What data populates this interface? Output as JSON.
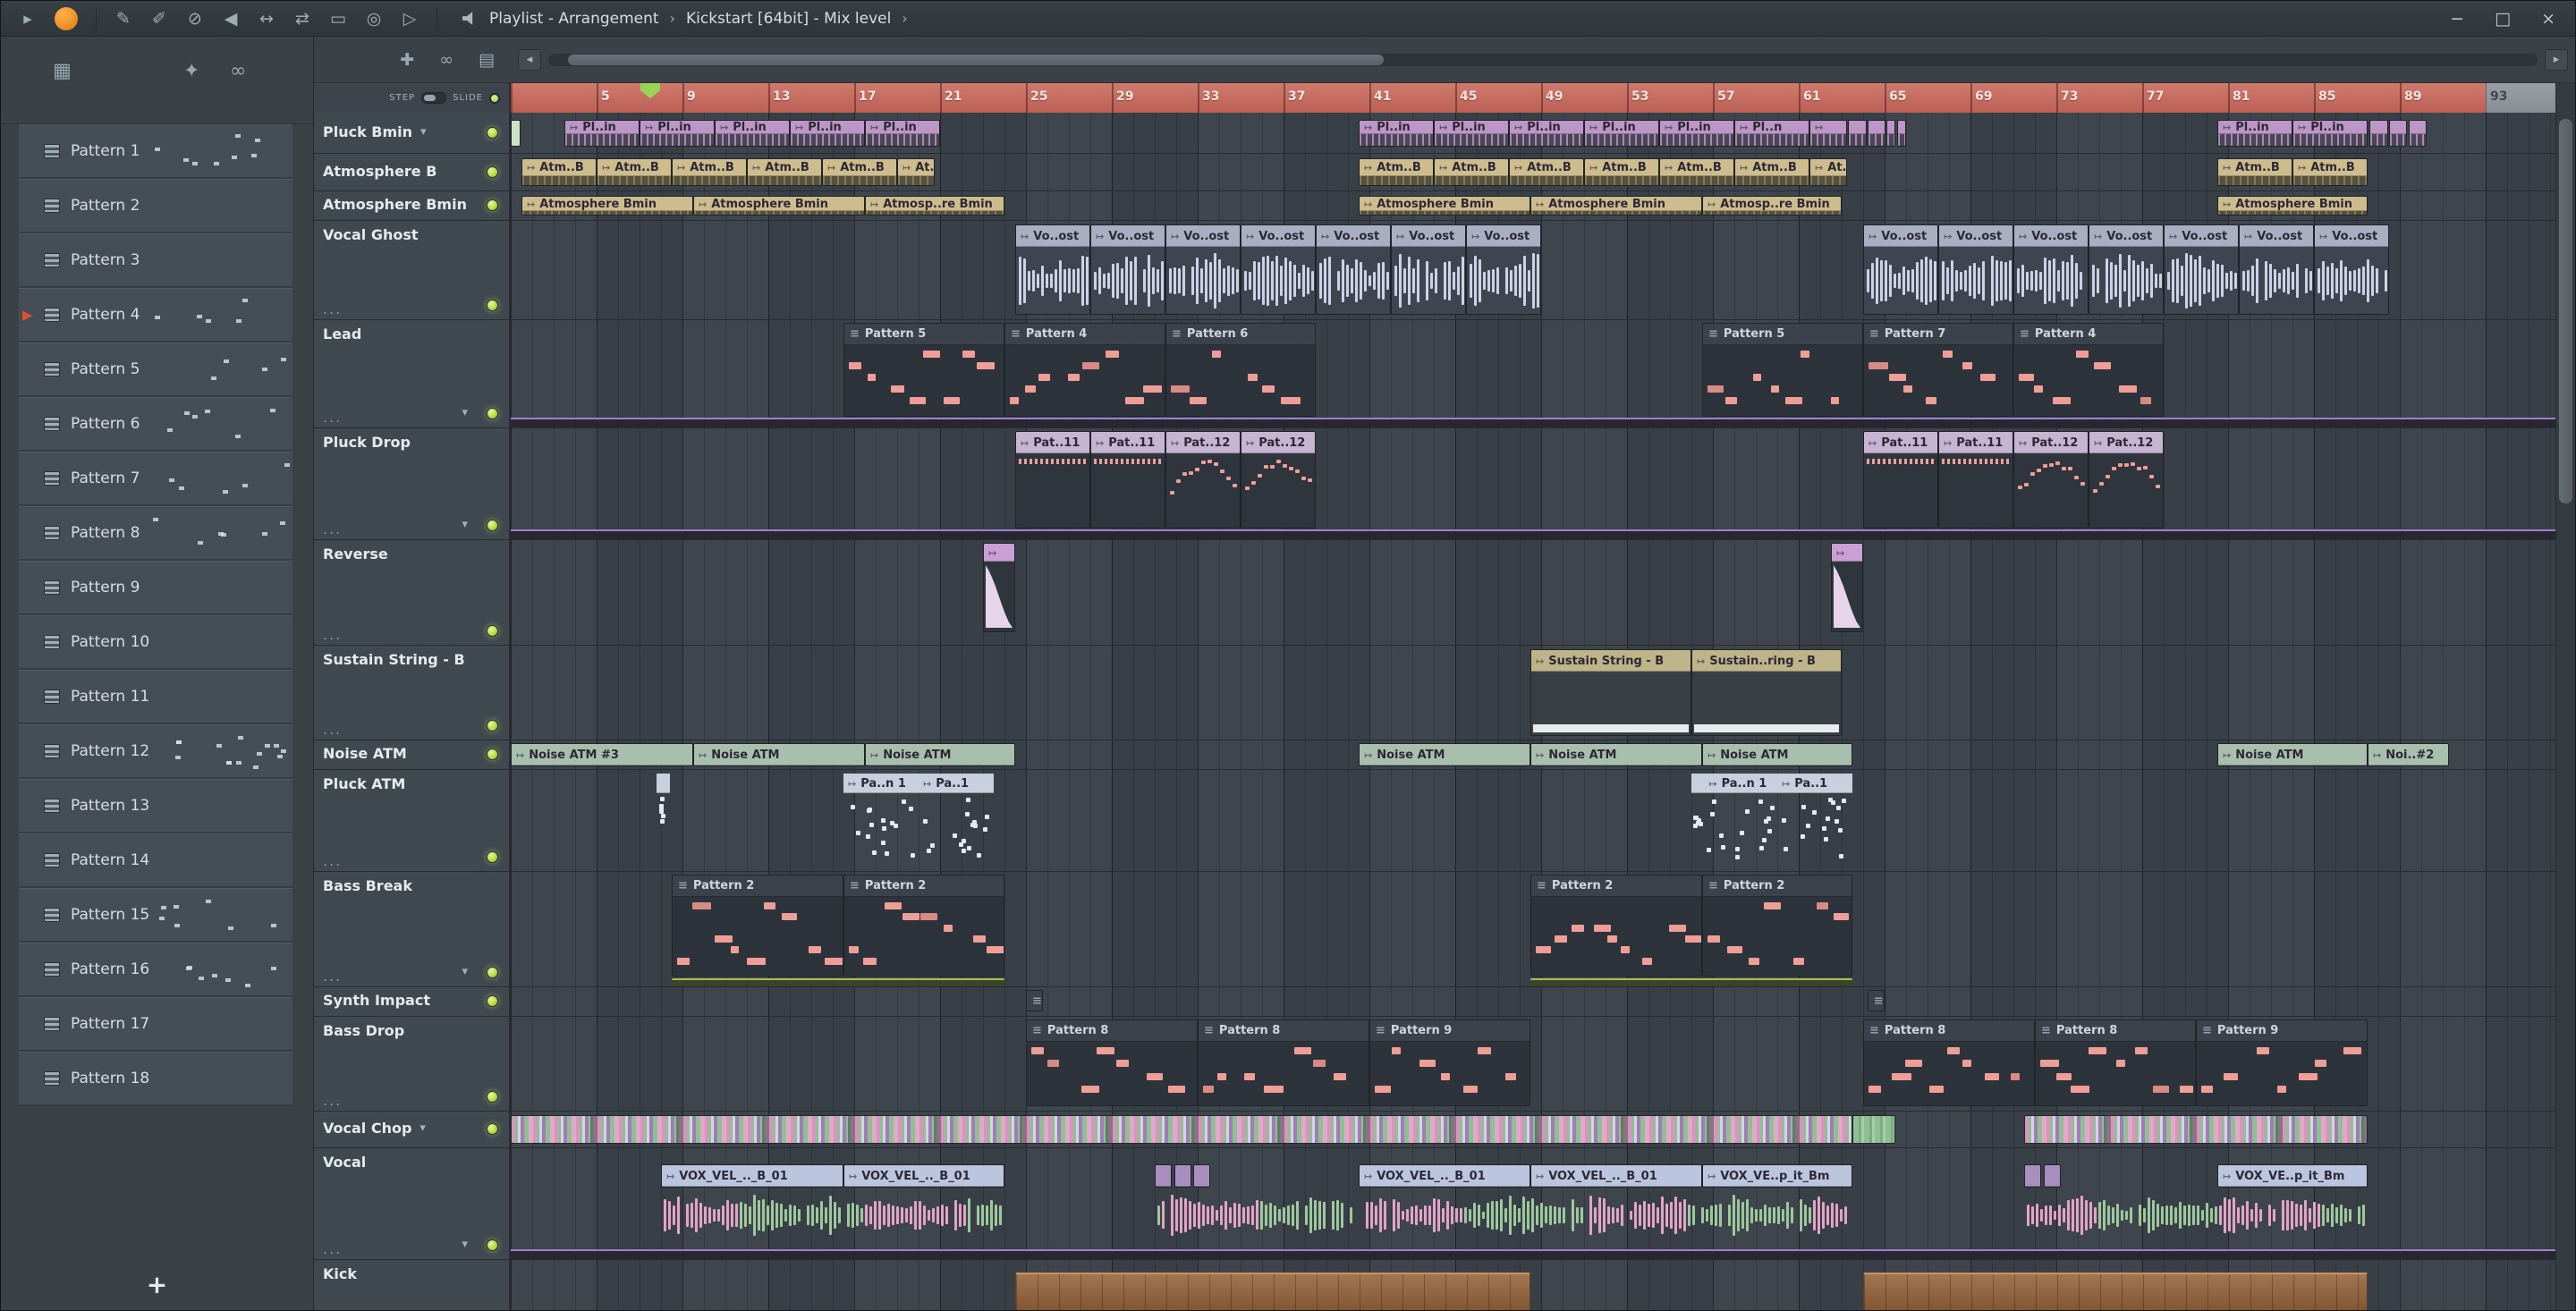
{
  "titlebar": {
    "play_glyph": "▸",
    "tools": [
      {
        "name": "draw-tool-icon",
        "glyph": "✎"
      },
      {
        "name": "paint-tool-icon",
        "glyph": "✐"
      },
      {
        "name": "delete-tool-icon",
        "glyph": "⊘"
      },
      {
        "name": "mute-tool-icon",
        "glyph": "◀"
      },
      {
        "name": "slip-tool-icon",
        "glyph": "↔"
      },
      {
        "name": "slide-tool-icon",
        "glyph": "⇄"
      },
      {
        "name": "select-tool-icon",
        "glyph": "▭"
      },
      {
        "name": "zoom-tool-icon",
        "glyph": "◎"
      },
      {
        "name": "playback-tool-icon",
        "glyph": "▷"
      }
    ],
    "title_left": "Playlist - Arrangement",
    "title_sep": "›",
    "title_right": "Kickstart [64bit] - Mix level",
    "window_controls": {
      "minimize": "−",
      "maximize": "□",
      "close": "×"
    }
  },
  "left_panel": {
    "tabs": [
      {
        "name": "patterns-tab-icon",
        "glyph": "▦"
      },
      {
        "name": "audio-tab-icon",
        "glyph": "✦"
      },
      {
        "name": "automation-tab-icon",
        "glyph": "∞"
      }
    ],
    "patterns": [
      "Pattern 1",
      "Pattern 2",
      "Pattern 3",
      "Pattern 4",
      "Pattern 5",
      "Pattern 6",
      "Pattern 7",
      "Pattern 8",
      "Pattern 9",
      "Pattern 10",
      "Pattern 11",
      "Pattern 12",
      "Pattern 13",
      "Pattern 14",
      "Pattern 15",
      "Pattern 16",
      "Pattern 17",
      "Pattern 18"
    ],
    "active_pattern": "Pattern 4",
    "preview_patterns": [
      1,
      4,
      5,
      6,
      7,
      8,
      12,
      15,
      16
    ],
    "add_label": "+"
  },
  "playlist": {
    "tools": [
      {
        "name": "arrange-icon",
        "glyph": "✚"
      },
      {
        "name": "link-icon",
        "glyph": "∞"
      },
      {
        "name": "view-icon",
        "glyph": "▤"
      }
    ],
    "scroll_left_glyph": "◂",
    "scroll_right_glyph": "▸",
    "step_label": "STEP",
    "slide_label": "SLIDE",
    "ruler_numbers": [
      5,
      9,
      13,
      17,
      21,
      25,
      29,
      33,
      37,
      41,
      45,
      49,
      53,
      57,
      61,
      65,
      69,
      73,
      77,
      81,
      85,
      89,
      93
    ],
    "playhead_bar": 7.5,
    "tracks": [
      {
        "name": "Pluck Bmin",
        "h": 46,
        "led": "top",
        "arrow": "inline"
      },
      {
        "name": "Atmosphere B",
        "h": 42,
        "led": "top"
      },
      {
        "name": "Atmosphere Bmin",
        "h": 33,
        "led": "top"
      },
      {
        "name": "Vocal Ghost",
        "h": 111,
        "led": "bottom",
        "dots": true
      },
      {
        "name": "Lead",
        "h": 121,
        "led": "bottom",
        "dots": true,
        "arrow": "bottom",
        "autoline": true
      },
      {
        "name": "Pluck Drop",
        "h": 125,
        "led": "bottom",
        "dots": true,
        "arrow": "bottom",
        "autoline": true
      },
      {
        "name": "Reverse",
        "h": 118,
        "led": "bottom",
        "dots": true
      },
      {
        "name": "Sustain String - B",
        "h": 106,
        "led": "bottom",
        "dots": true
      },
      {
        "name": "Noise ATM",
        "h": 33,
        "led": "top"
      },
      {
        "name": "Pluck ATM",
        "h": 114,
        "led": "bottom",
        "dots": true
      },
      {
        "name": "Bass Break",
        "h": 129,
        "led": "bottom",
        "dots": true,
        "arrow": "bottom"
      },
      {
        "name": "Synth Impact",
        "h": 33,
        "led": "top"
      },
      {
        "name": "Bass Drop",
        "h": 106,
        "led": "bottom",
        "dots": true
      },
      {
        "name": "Vocal Chop",
        "h": 41,
        "led": "top",
        "arrow": "inline"
      },
      {
        "name": "Vocal",
        "h": 125,
        "led": "bottom",
        "dots": true,
        "arrow": "bottom",
        "autoline": true
      },
      {
        "name": "Kick",
        "h": 60,
        "led": "none"
      }
    ],
    "clips": [
      [
        0,
        1,
        0.45,
        "",
        "sliver"
      ],
      [
        0,
        3.5,
        3.5,
        "Pl..in",
        "pluck"
      ],
      [
        0,
        7,
        3.5,
        "Pl..in",
        "pluck"
      ],
      [
        0,
        10.5,
        3.5,
        "Pl..in",
        "pluck"
      ],
      [
        0,
        14,
        3.5,
        "Pl..in",
        "pluck"
      ],
      [
        0,
        17.5,
        3.5,
        "Pl..in",
        "pluck"
      ],
      [
        0,
        40.5,
        3.5,
        "Pl..in",
        "pluck"
      ],
      [
        0,
        44,
        3.5,
        "Pl..in",
        "pluck"
      ],
      [
        0,
        47.5,
        3.5,
        "Pl..in",
        "pluck"
      ],
      [
        0,
        51,
        3.5,
        "Pl..in",
        "pluck"
      ],
      [
        0,
        54.5,
        3.5,
        "Pl..in",
        "pluck"
      ],
      [
        0,
        58,
        3.5,
        "Pl..n",
        "pluck"
      ],
      [
        0,
        61.5,
        1.75,
        "",
        "pluck"
      ],
      [
        0,
        63.3,
        0.85,
        "",
        "pluck"
      ],
      [
        0,
        64.2,
        0.85,
        "",
        "pluck"
      ],
      [
        0,
        65.1,
        0.4,
        "",
        "pluck"
      ],
      [
        0,
        65.6,
        0.4,
        "",
        "pluck"
      ],
      [
        0,
        80.5,
        3.5,
        "Pl..in",
        "pluck"
      ],
      [
        0,
        84,
        3.5,
        "Pl..in",
        "pluck"
      ],
      [
        0,
        87.6,
        0.85,
        "",
        "pluck"
      ],
      [
        0,
        88.5,
        0.85,
        "",
        "pluck"
      ],
      [
        0,
        89.4,
        0.85,
        "",
        "pluck"
      ],
      [
        1,
        1.5,
        3.5,
        "Atm..B",
        "atmo"
      ],
      [
        1,
        5,
        3.5,
        "Atm..B",
        "atmo"
      ],
      [
        1,
        8.5,
        3.5,
        "Atm..B",
        "atmo"
      ],
      [
        1,
        12,
        3.5,
        "Atm..B",
        "atmo"
      ],
      [
        1,
        15.5,
        3.5,
        "Atm..B",
        "atmo"
      ],
      [
        1,
        19,
        1.75,
        "At..B",
        "atmo"
      ],
      [
        1,
        40.5,
        3.5,
        "Atm..B",
        "atmo"
      ],
      [
        1,
        44,
        3.5,
        "Atm..B",
        "atmo"
      ],
      [
        1,
        47.5,
        3.5,
        "Atm..B",
        "atmo"
      ],
      [
        1,
        51,
        3.5,
        "Atm..B",
        "atmo"
      ],
      [
        1,
        54.5,
        3.5,
        "Atm..B",
        "atmo"
      ],
      [
        1,
        58,
        3.5,
        "Atm..B",
        "atmo"
      ],
      [
        1,
        61.5,
        1.75,
        "At..B",
        "atmo"
      ],
      [
        1,
        80.5,
        3.5,
        "Atm..B",
        "atmo"
      ],
      [
        1,
        84,
        3.5,
        "Atm..B",
        "atmo"
      ],
      [
        2,
        1.5,
        8,
        "Atmosphere Bmin",
        "atmo"
      ],
      [
        2,
        9.5,
        8,
        "Atmosphere Bmin",
        "atmo"
      ],
      [
        2,
        17.5,
        6.5,
        "Atmosp..re Bmin",
        "atmo"
      ],
      [
        2,
        40.5,
        8,
        "Atmosphere Bmin",
        "atmo"
      ],
      [
        2,
        48.5,
        8,
        "Atmosphere Bmin",
        "atmo"
      ],
      [
        2,
        56.5,
        6.5,
        "Atmosp..re Bmin",
        "atmo"
      ],
      [
        2,
        80.5,
        7,
        "Atmosphere Bmin",
        "atmo"
      ],
      [
        3,
        24.5,
        3.5,
        "Vo..ost",
        "ghost"
      ],
      [
        3,
        28,
        3.5,
        "Vo..ost",
        "ghost"
      ],
      [
        3,
        31.5,
        3.5,
        "Vo..ost",
        "ghost"
      ],
      [
        3,
        35,
        3.5,
        "Vo..ost",
        "ghost"
      ],
      [
        3,
        38.5,
        3.5,
        "Vo..ost",
        "ghost"
      ],
      [
        3,
        42,
        3.5,
        "Vo..ost",
        "ghost"
      ],
      [
        3,
        45.5,
        3.5,
        "Vo..ost",
        "ghost"
      ],
      [
        3,
        64,
        3.5,
        "Vo..ost",
        "ghost"
      ],
      [
        3,
        67.5,
        3.5,
        "Vo..ost",
        "ghost"
      ],
      [
        3,
        71,
        3.5,
        "Vo..ost",
        "ghost"
      ],
      [
        3,
        74.5,
        3.5,
        "Vo..ost",
        "ghost"
      ],
      [
        3,
        78,
        3.5,
        "Vo..ost",
        "ghost"
      ],
      [
        3,
        81.5,
        3.5,
        "Vo..ost",
        "ghost"
      ],
      [
        3,
        85,
        3.5,
        "Vo..ost",
        "ghost"
      ],
      [
        4,
        16.5,
        7.5,
        "Pattern 5",
        "midi"
      ],
      [
        4,
        24,
        7.5,
        "Pattern 4",
        "midi"
      ],
      [
        4,
        31.5,
        7,
        "Pattern 6",
        "midi"
      ],
      [
        4,
        56.5,
        7.5,
        "Pattern 5",
        "midi"
      ],
      [
        4,
        64,
        7,
        "Pattern 7",
        "midi"
      ],
      [
        4,
        71,
        7,
        "Pattern 4",
        "midi"
      ],
      [
        5,
        24.5,
        3.5,
        "Pat..11",
        "dropdash"
      ],
      [
        5,
        28,
        3.5,
        "Pat..11",
        "dropdash"
      ],
      [
        5,
        31.5,
        3.5,
        "Pat..12",
        "droparch"
      ],
      [
        5,
        35,
        3.5,
        "Pat..12",
        "droparch"
      ],
      [
        5,
        64,
        3.5,
        "Pat..11",
        "dropdash"
      ],
      [
        5,
        67.5,
        3.5,
        "Pat..11",
        "dropdash"
      ],
      [
        5,
        71,
        3.5,
        "Pat..12",
        "droparch"
      ],
      [
        5,
        74.5,
        3.5,
        "Pat..12",
        "droparch"
      ],
      [
        6,
        23,
        1.5,
        "",
        "reverse"
      ],
      [
        6,
        62.5,
        1.5,
        "",
        "reverse"
      ],
      [
        7,
        48.5,
        7.5,
        "Sustain String - B",
        "sustain"
      ],
      [
        7,
        56,
        7,
        "Sustain..ring - B",
        "sustain"
      ],
      [
        8,
        1,
        8.5,
        "Noise ATM #3",
        "noise"
      ],
      [
        8,
        9.5,
        8,
        "Noise ATM",
        "noise"
      ],
      [
        8,
        17.5,
        7,
        "Noise ATM",
        "noise"
      ],
      [
        8,
        40.5,
        8,
        "Noise ATM",
        "noise"
      ],
      [
        8,
        48.5,
        8,
        "Noise ATM",
        "noise"
      ],
      [
        8,
        56.5,
        7,
        "Noise ATM",
        "noise"
      ],
      [
        8,
        80.5,
        7,
        "Noise ATM",
        "noise"
      ],
      [
        8,
        87.5,
        3.8,
        "Noi..#2",
        "noise"
      ],
      [
        9,
        7.8,
        0.6,
        "",
        "patm"
      ],
      [
        9,
        16.5,
        3.5,
        "Pa..n 1",
        "patm"
      ],
      [
        9,
        20,
        3.5,
        "Pa..1",
        "patm"
      ],
      [
        9,
        56,
        0.6,
        "",
        "patm"
      ],
      [
        9,
        56.6,
        3.4,
        "Pa..n 1",
        "patm"
      ],
      [
        9,
        60,
        3.5,
        "Pa..1",
        "patm"
      ],
      [
        10,
        8.5,
        8,
        "Pattern 2",
        "midi"
      ],
      [
        10,
        16.5,
        7.5,
        "Pattern 2",
        "midi"
      ],
      [
        10,
        48.5,
        8,
        "Pattern 2",
        "midi"
      ],
      [
        10,
        56.5,
        7,
        "Pattern 2",
        "midi"
      ],
      [
        10,
        8.5,
        15.5,
        "",
        "olive"
      ],
      [
        10,
        48.5,
        15,
        "",
        "olive"
      ],
      [
        11,
        25,
        0.8,
        "",
        "tiny"
      ],
      [
        11,
        64.2,
        0.8,
        "",
        "tiny"
      ],
      [
        12,
        25,
        8,
        "Pattern 8",
        "midi"
      ],
      [
        12,
        33,
        8,
        "Pattern 8",
        "midi"
      ],
      [
        12,
        41,
        7.5,
        "Pattern 9",
        "midi"
      ],
      [
        12,
        64,
        8,
        "Pattern 8",
        "midi"
      ],
      [
        12,
        72,
        7.5,
        "Pattern 8",
        "midi"
      ],
      [
        12,
        79.5,
        8,
        "Pattern 9",
        "midi"
      ],
      [
        13,
        1,
        62.5,
        "",
        "chop"
      ],
      [
        13,
        63.5,
        2,
        "",
        "chopg"
      ],
      [
        13,
        71.5,
        16,
        "",
        "chop"
      ],
      [
        14,
        8,
        16,
        "",
        "vwave"
      ],
      [
        14,
        31,
        9.5,
        "",
        "vwave"
      ],
      [
        14,
        40.5,
        23,
        "",
        "vwave"
      ],
      [
        14,
        71.5,
        16,
        "",
        "vwave"
      ],
      [
        14,
        8,
        8.5,
        "VOX_VEL_.._B_01",
        "vocal"
      ],
      [
        14,
        16.5,
        7.5,
        "VOX_VEL_.._B_01",
        "vocal"
      ],
      [
        14,
        31,
        0.8,
        "",
        "vtiny"
      ],
      [
        14,
        31.9,
        0.8,
        "",
        "vtiny"
      ],
      [
        14,
        32.8,
        0.8,
        "",
        "vtiny"
      ],
      [
        14,
        40.5,
        8,
        "VOX_VEL_.._B_01",
        "vocal"
      ],
      [
        14,
        48.5,
        8,
        "VOX_VEL_.._B_01",
        "vocal"
      ],
      [
        14,
        56.5,
        7,
        "VOX_VE..p_it_Bm",
        "vocal"
      ],
      [
        14,
        71.5,
        0.8,
        "",
        "vtiny"
      ],
      [
        14,
        72.4,
        0.8,
        "",
        "vtiny"
      ],
      [
        14,
        80.5,
        7,
        "VOX_VE..p_it_Bm",
        "vocal"
      ],
      [
        15,
        24.5,
        24,
        "",
        "kick"
      ],
      [
        15,
        64,
        23.5,
        "",
        "kick"
      ]
    ]
  },
  "colors": {
    "accent_green": "#b8d846",
    "ruler_red": "#c96a60",
    "playhead_green": "#9ad455",
    "pluck": "#bb96c6",
    "pluck_body": "#4e4458",
    "atmo": "#cdbc8e",
    "atmo_body": "#56513c",
    "ghost": "#a9afc2",
    "ghost_wave": "#ccd1e4",
    "midi_note": "#ee9e96",
    "drop": "#c7b3d2",
    "sustain": "#bdb489",
    "noise": "#a9bfae",
    "patm": "#c9d0dd",
    "patm_dot": "#e3e8f2",
    "vocal": "#bcc5de",
    "vocal_tiny": "#a98fc0",
    "wave_pink": "#e2a3c6",
    "wave_green": "#9cc89c",
    "kick": "#9c6a3f",
    "auto_purple": "#9a84c8",
    "olive": "#a8bd54"
  }
}
